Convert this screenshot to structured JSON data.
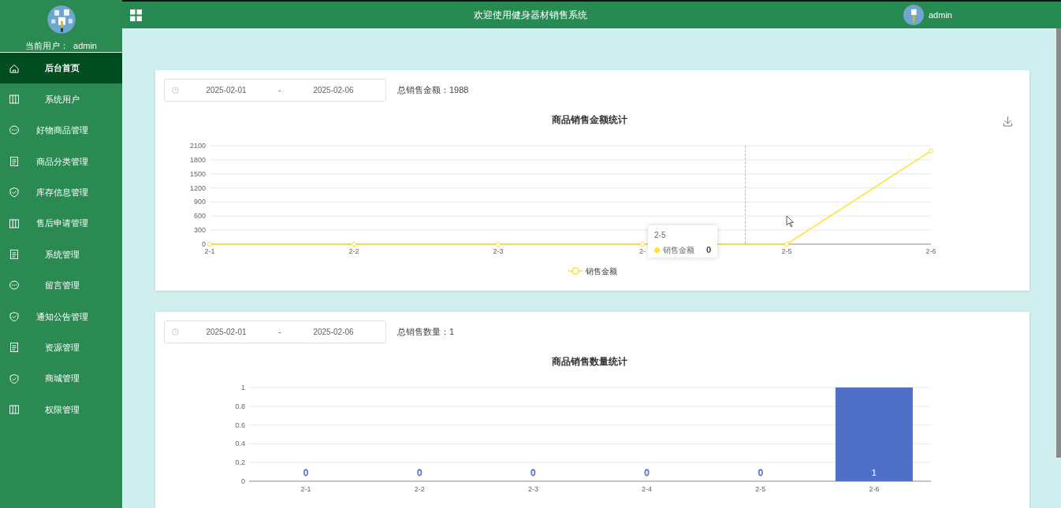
{
  "sidebar": {
    "current_user_label": "当前用户：",
    "current_user": "admin",
    "items": [
      {
        "label": "后台首页",
        "selected": true
      },
      {
        "label": "系统用户",
        "selected": false
      },
      {
        "label": "好物商品管理",
        "selected": false
      },
      {
        "label": "商品分类管理",
        "selected": false
      },
      {
        "label": "库存信息管理",
        "selected": false
      },
      {
        "label": "售后申请管理",
        "selected": false
      },
      {
        "label": "系统管理",
        "selected": false
      },
      {
        "label": "留言管理",
        "selected": false
      },
      {
        "label": "通知公告管理",
        "selected": false
      },
      {
        "label": "资源管理",
        "selected": false
      },
      {
        "label": "商城管理",
        "selected": false
      },
      {
        "label": "权限管理",
        "selected": false
      }
    ]
  },
  "header": {
    "title": "欢迎使用健身器材销售系统",
    "user": "admin"
  },
  "panels": [
    {
      "date_start": "2025-02-01",
      "separator": "-",
      "date_end": "2025-02-06",
      "total": "总销售金额：1988",
      "tooltip": {
        "title": "2-5",
        "series": "销售金额",
        "value": "0"
      },
      "chart_data": {
        "type": "line",
        "title": "商品销售金额统计",
        "categories": [
          "2-1",
          "2-2",
          "2-3",
          "2-",
          "2-5",
          "2-6"
        ],
        "grid": true,
        "series": [
          {
            "name": "销售金额",
            "color": "#ffe433",
            "marker": true,
            "values": [
              0,
              0,
              0,
              0,
              0,
              1988
            ]
          }
        ],
        "ylim": [
          0,
          2100
        ],
        "yticks": [
          0,
          300,
          600,
          900,
          1200,
          1500,
          1800,
          2100
        ]
      }
    },
    {
      "date_start": "2025-02-01",
      "separator": "-",
      "date_end": "2025-02-06",
      "total": "总销售数量：1",
      "chart_data": {
        "type": "bar",
        "title": "商品销售数量统计",
        "categories": [
          "2-1",
          "2-2",
          "2-3",
          "2-4",
          "2-5",
          "2-6"
        ],
        "grid": true,
        "series": [
          {
            "color": "#5070c8",
            "values": [
              0,
              0,
              0,
              0,
              0,
              1
            ]
          }
        ],
        "ylim": [
          0,
          1
        ],
        "yticks": [
          0,
          0.2,
          0.4,
          0.6,
          0.8,
          1
        ],
        "data_labels": true
      }
    }
  ]
}
